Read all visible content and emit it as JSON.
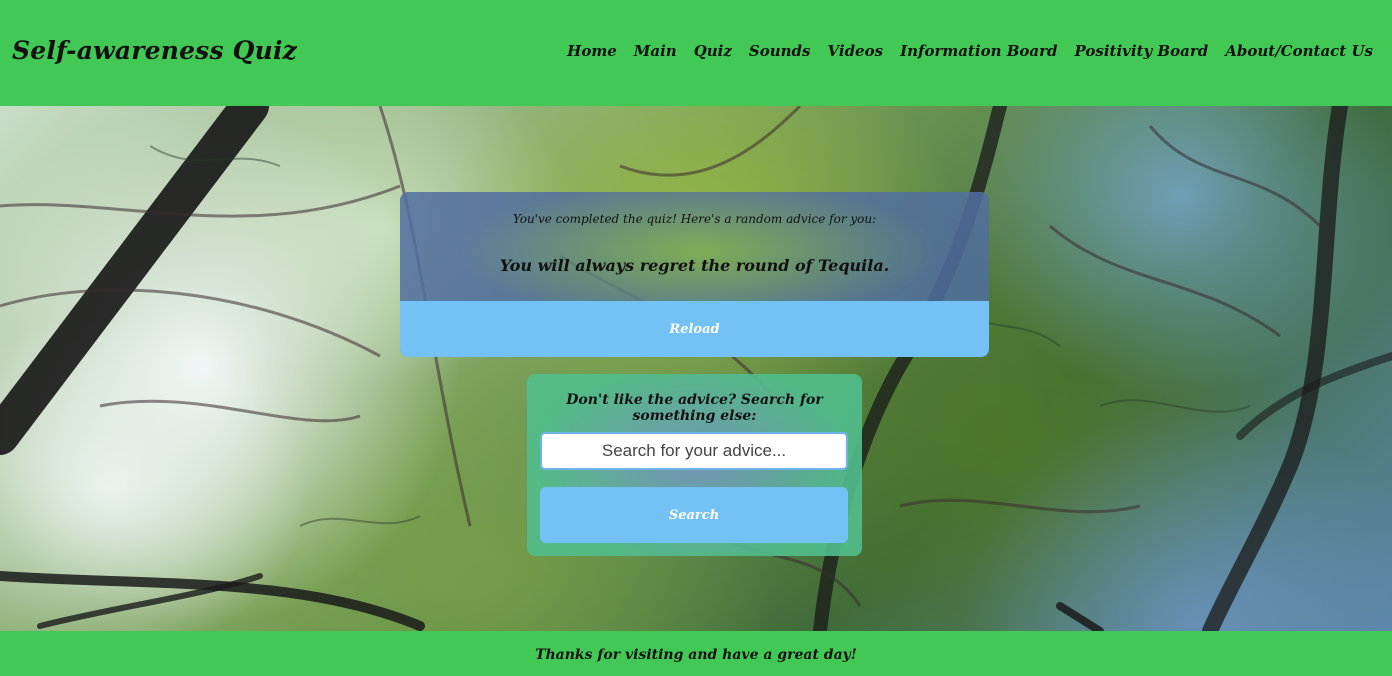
{
  "header": {
    "brand": "Self-awareness Quiz",
    "nav": [
      {
        "label": "Home"
      },
      {
        "label": "Main"
      },
      {
        "label": "Quiz"
      },
      {
        "label": "Sounds"
      },
      {
        "label": "Videos"
      },
      {
        "label": "Information Board"
      },
      {
        "label": "Positivity Board"
      },
      {
        "label": "About/Contact Us"
      }
    ]
  },
  "advice": {
    "intro": "You've completed the quiz! Here's a random advice for you:",
    "text": "You will always regret the round of Tequila.",
    "reload_label": "Reload"
  },
  "search": {
    "prompt": "Don't like the advice? Search for something else:",
    "placeholder": "Search for your advice...",
    "button_label": "Search"
  },
  "footer": {
    "text": "Thanks for visiting and have a great day!"
  },
  "colors": {
    "header_green": "#42c955",
    "button_blue": "#74c2f5"
  }
}
